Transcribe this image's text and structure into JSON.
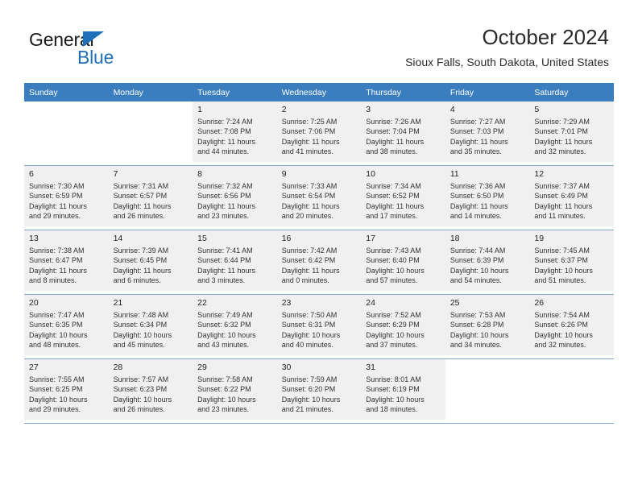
{
  "brand": {
    "name_line1": "General",
    "name_line2": "Blue",
    "logo_icon": "triangle-logo-icon"
  },
  "header": {
    "month_title": "October 2024",
    "location": "Sioux Falls, South Dakota, United States"
  },
  "calendar": {
    "weekday_headers": [
      "Sunday",
      "Monday",
      "Tuesday",
      "Wednesday",
      "Thursday",
      "Friday",
      "Saturday"
    ],
    "header_bg": "#3a7ebf",
    "shaded_bg": "#f0f0f0",
    "grid_line": "#7fa9cf",
    "weeks": [
      [
        {
          "day": "",
          "sunrise": "",
          "sunset": "",
          "daylight_line1": "",
          "daylight_line2": "",
          "empty": true
        },
        {
          "day": "",
          "sunrise": "",
          "sunset": "",
          "daylight_line1": "",
          "daylight_line2": "",
          "empty": true
        },
        {
          "day": "1",
          "sunrise": "Sunrise: 7:24 AM",
          "sunset": "Sunset: 7:08 PM",
          "daylight_line1": "Daylight: 11 hours",
          "daylight_line2": "and 44 minutes."
        },
        {
          "day": "2",
          "sunrise": "Sunrise: 7:25 AM",
          "sunset": "Sunset: 7:06 PM",
          "daylight_line1": "Daylight: 11 hours",
          "daylight_line2": "and 41 minutes."
        },
        {
          "day": "3",
          "sunrise": "Sunrise: 7:26 AM",
          "sunset": "Sunset: 7:04 PM",
          "daylight_line1": "Daylight: 11 hours",
          "daylight_line2": "and 38 minutes."
        },
        {
          "day": "4",
          "sunrise": "Sunrise: 7:27 AM",
          "sunset": "Sunset: 7:03 PM",
          "daylight_line1": "Daylight: 11 hours",
          "daylight_line2": "and 35 minutes."
        },
        {
          "day": "5",
          "sunrise": "Sunrise: 7:29 AM",
          "sunset": "Sunset: 7:01 PM",
          "daylight_line1": "Daylight: 11 hours",
          "daylight_line2": "and 32 minutes."
        }
      ],
      [
        {
          "day": "6",
          "sunrise": "Sunrise: 7:30 AM",
          "sunset": "Sunset: 6:59 PM",
          "daylight_line1": "Daylight: 11 hours",
          "daylight_line2": "and 29 minutes."
        },
        {
          "day": "7",
          "sunrise": "Sunrise: 7:31 AM",
          "sunset": "Sunset: 6:57 PM",
          "daylight_line1": "Daylight: 11 hours",
          "daylight_line2": "and 26 minutes."
        },
        {
          "day": "8",
          "sunrise": "Sunrise: 7:32 AM",
          "sunset": "Sunset: 6:56 PM",
          "daylight_line1": "Daylight: 11 hours",
          "daylight_line2": "and 23 minutes."
        },
        {
          "day": "9",
          "sunrise": "Sunrise: 7:33 AM",
          "sunset": "Sunset: 6:54 PM",
          "daylight_line1": "Daylight: 11 hours",
          "daylight_line2": "and 20 minutes."
        },
        {
          "day": "10",
          "sunrise": "Sunrise: 7:34 AM",
          "sunset": "Sunset: 6:52 PM",
          "daylight_line1": "Daylight: 11 hours",
          "daylight_line2": "and 17 minutes."
        },
        {
          "day": "11",
          "sunrise": "Sunrise: 7:36 AM",
          "sunset": "Sunset: 6:50 PM",
          "daylight_line1": "Daylight: 11 hours",
          "daylight_line2": "and 14 minutes."
        },
        {
          "day": "12",
          "sunrise": "Sunrise: 7:37 AM",
          "sunset": "Sunset: 6:49 PM",
          "daylight_line1": "Daylight: 11 hours",
          "daylight_line2": "and 11 minutes."
        }
      ],
      [
        {
          "day": "13",
          "sunrise": "Sunrise: 7:38 AM",
          "sunset": "Sunset: 6:47 PM",
          "daylight_line1": "Daylight: 11 hours",
          "daylight_line2": "and 8 minutes."
        },
        {
          "day": "14",
          "sunrise": "Sunrise: 7:39 AM",
          "sunset": "Sunset: 6:45 PM",
          "daylight_line1": "Daylight: 11 hours",
          "daylight_line2": "and 6 minutes."
        },
        {
          "day": "15",
          "sunrise": "Sunrise: 7:41 AM",
          "sunset": "Sunset: 6:44 PM",
          "daylight_line1": "Daylight: 11 hours",
          "daylight_line2": "and 3 minutes."
        },
        {
          "day": "16",
          "sunrise": "Sunrise: 7:42 AM",
          "sunset": "Sunset: 6:42 PM",
          "daylight_line1": "Daylight: 11 hours",
          "daylight_line2": "and 0 minutes."
        },
        {
          "day": "17",
          "sunrise": "Sunrise: 7:43 AM",
          "sunset": "Sunset: 6:40 PM",
          "daylight_line1": "Daylight: 10 hours",
          "daylight_line2": "and 57 minutes."
        },
        {
          "day": "18",
          "sunrise": "Sunrise: 7:44 AM",
          "sunset": "Sunset: 6:39 PM",
          "daylight_line1": "Daylight: 10 hours",
          "daylight_line2": "and 54 minutes."
        },
        {
          "day": "19",
          "sunrise": "Sunrise: 7:45 AM",
          "sunset": "Sunset: 6:37 PM",
          "daylight_line1": "Daylight: 10 hours",
          "daylight_line2": "and 51 minutes."
        }
      ],
      [
        {
          "day": "20",
          "sunrise": "Sunrise: 7:47 AM",
          "sunset": "Sunset: 6:35 PM",
          "daylight_line1": "Daylight: 10 hours",
          "daylight_line2": "and 48 minutes."
        },
        {
          "day": "21",
          "sunrise": "Sunrise: 7:48 AM",
          "sunset": "Sunset: 6:34 PM",
          "daylight_line1": "Daylight: 10 hours",
          "daylight_line2": "and 45 minutes."
        },
        {
          "day": "22",
          "sunrise": "Sunrise: 7:49 AM",
          "sunset": "Sunset: 6:32 PM",
          "daylight_line1": "Daylight: 10 hours",
          "daylight_line2": "and 43 minutes."
        },
        {
          "day": "23",
          "sunrise": "Sunrise: 7:50 AM",
          "sunset": "Sunset: 6:31 PM",
          "daylight_line1": "Daylight: 10 hours",
          "daylight_line2": "and 40 minutes."
        },
        {
          "day": "24",
          "sunrise": "Sunrise: 7:52 AM",
          "sunset": "Sunset: 6:29 PM",
          "daylight_line1": "Daylight: 10 hours",
          "daylight_line2": "and 37 minutes."
        },
        {
          "day": "25",
          "sunrise": "Sunrise: 7:53 AM",
          "sunset": "Sunset: 6:28 PM",
          "daylight_line1": "Daylight: 10 hours",
          "daylight_line2": "and 34 minutes."
        },
        {
          "day": "26",
          "sunrise": "Sunrise: 7:54 AM",
          "sunset": "Sunset: 6:26 PM",
          "daylight_line1": "Daylight: 10 hours",
          "daylight_line2": "and 32 minutes."
        }
      ],
      [
        {
          "day": "27",
          "sunrise": "Sunrise: 7:55 AM",
          "sunset": "Sunset: 6:25 PM",
          "daylight_line1": "Daylight: 10 hours",
          "daylight_line2": "and 29 minutes."
        },
        {
          "day": "28",
          "sunrise": "Sunrise: 7:57 AM",
          "sunset": "Sunset: 6:23 PM",
          "daylight_line1": "Daylight: 10 hours",
          "daylight_line2": "and 26 minutes."
        },
        {
          "day": "29",
          "sunrise": "Sunrise: 7:58 AM",
          "sunset": "Sunset: 6:22 PM",
          "daylight_line1": "Daylight: 10 hours",
          "daylight_line2": "and 23 minutes."
        },
        {
          "day": "30",
          "sunrise": "Sunrise: 7:59 AM",
          "sunset": "Sunset: 6:20 PM",
          "daylight_line1": "Daylight: 10 hours",
          "daylight_line2": "and 21 minutes."
        },
        {
          "day": "31",
          "sunrise": "Sunrise: 8:01 AM",
          "sunset": "Sunset: 6:19 PM",
          "daylight_line1": "Daylight: 10 hours",
          "daylight_line2": "and 18 minutes."
        },
        {
          "day": "",
          "sunrise": "",
          "sunset": "",
          "daylight_line1": "",
          "daylight_line2": "",
          "empty": true
        },
        {
          "day": "",
          "sunrise": "",
          "sunset": "",
          "daylight_line1": "",
          "daylight_line2": "",
          "empty": true
        }
      ]
    ]
  }
}
